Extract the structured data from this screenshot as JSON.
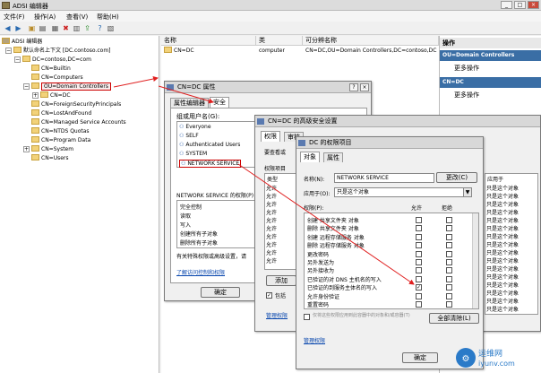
{
  "window": {
    "title": "ADSI 编辑器"
  },
  "menu": {
    "file": "文件(F)",
    "action": "操作(A)",
    "view": "查看(V)",
    "help": "帮助(H)"
  },
  "tree": {
    "root": "ADSI 编辑器",
    "context": "默认命名上下文 [DC.contoso.com]",
    "domain": "DC=contoso,DC=com",
    "items": [
      "CN=Builtin",
      "CN=Computers",
      "OU=Domain Controllers",
      "CN=DC",
      "CN=ForeignSecurityPrincipals",
      "CN=LostAndFound",
      "CN=Managed Service Accounts",
      "CN=NTDS Quotas",
      "CN=Program Data",
      "CN=System",
      "CN=Users"
    ]
  },
  "list": {
    "headers": [
      "名称",
      "类",
      "可分辨名称"
    ],
    "row": {
      "name": "CN=DC",
      "class": "computer",
      "dn": "CN=DC,OU=Domain Controllers,DC=contoso,DC"
    }
  },
  "actions": {
    "head": "操作",
    "section1": "OU=Domain Controllers",
    "more1": "更多操作",
    "section2": "CN=DC",
    "more2": "更多操作"
  },
  "props": {
    "title": "CN=DC 属性",
    "tabs": [
      "属性编辑器",
      "安全"
    ],
    "group_label": "组或用户名(G):",
    "principals": [
      "Everyone",
      "SELF",
      "Authenticated Users",
      "SYSTEM",
      "NETWORK SERVICE"
    ],
    "perm_label": "NETWORK SERVICE 的权限(P)",
    "perms": [
      "完全控制",
      "读取",
      "写入",
      "创建所有子对象",
      "删除所有子对象"
    ],
    "note": "有关特殊权限或高级设置，请",
    "link": "了解访问控制和权限",
    "ok": "确定"
  },
  "adv": {
    "title": "CN=DC 的高级安全设置",
    "tabs": [
      "权限",
      "审核"
    ],
    "view_label": "要查看或",
    "entries_label": "权限项目",
    "type_col": "类型",
    "types": [
      "允许",
      "允许",
      "允许",
      "允许",
      "允许",
      "允许",
      "允许",
      "允许",
      "允许",
      "允许"
    ],
    "add": "添加",
    "include": "包括",
    "manage_link": "管理权限",
    "applies_col": "应用于",
    "applies": [
      "只是这个对象",
      "只是这个对象",
      "只是这个对象",
      "只是这个对象",
      "只是这个对象",
      "只是这个对象",
      "只是这个对象",
      "只是这个对象",
      "只是这个对象",
      "只是这个对象",
      "只是这个对象",
      "只是这个对象",
      "只是这个对象",
      "只是这个对象",
      "只是这个对象",
      "只是这个对象"
    ]
  },
  "entry": {
    "title": "DC 的权限项目",
    "tabs": [
      "对象",
      "属性"
    ],
    "name_label": "名称(N):",
    "name_value": "NETWORK SERVICE",
    "change": "更改(C)",
    "apply_label": "应用于(O):",
    "apply_value": "只是这个对象",
    "perm_label": "权限(P):",
    "allow": "允许",
    "deny": "拒绝",
    "rows": [
      "创建 共享文件夹 对象",
      "删除 共享文件夹 对象",
      "创建 远程存储服务 对象",
      "删除 远程存储服务 对象",
      "更改密码",
      "另外发送为",
      "另外接收为",
      "已验证的对 DNS 主机名的写入",
      "已验证的到服务主体名的写入",
      "允许身份验证",
      "重置密码"
    ],
    "checked_allow": [
      false,
      false,
      false,
      false,
      false,
      false,
      false,
      false,
      true,
      false,
      false
    ],
    "apply_note": "仅将这些权限应用到此容器中的对象和/或容器(T)",
    "clear_all": "全部清除(L)",
    "manage_link": "管理权限",
    "ok": "确定"
  },
  "watermark": {
    "brand": "运维网",
    "url": "iyunv.com"
  }
}
